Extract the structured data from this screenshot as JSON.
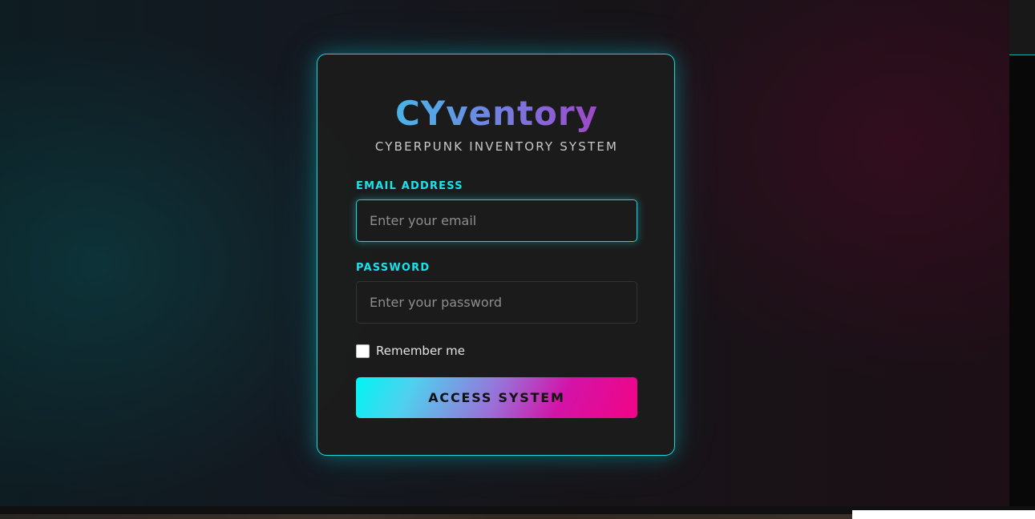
{
  "app": {
    "logo": "CYventory",
    "subtitle": "CYBERPUNK INVENTORY SYSTEM"
  },
  "form": {
    "email": {
      "label": "EMAIL ADDRESS",
      "value": "",
      "placeholder": "Enter your email"
    },
    "password": {
      "label": "PASSWORD",
      "value": "",
      "placeholder": "Enter your password"
    },
    "remember": {
      "label": "Remember me",
      "checked": false
    },
    "submit_label": "ACCESS SYSTEM"
  },
  "colors": {
    "accent_cyan": "#19e3ea",
    "accent_magenta": "#f20486",
    "card_background": "#1c1c1c"
  }
}
